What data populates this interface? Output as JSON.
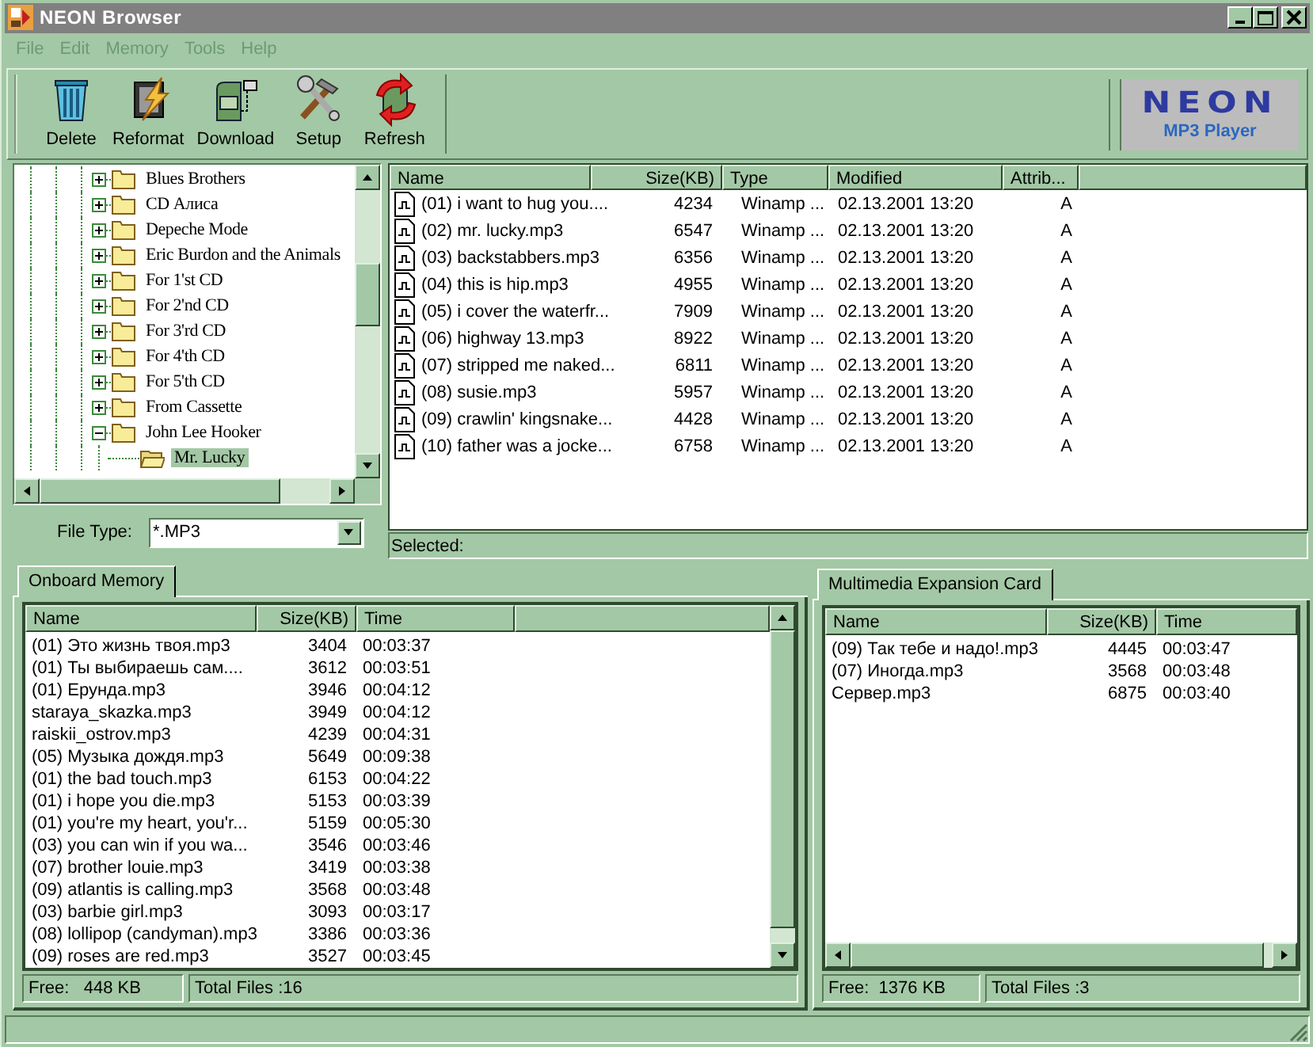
{
  "window": {
    "title": "NEON Browser"
  },
  "menu": [
    "File",
    "Edit",
    "Memory",
    "Tools",
    "Help"
  ],
  "toolbar": [
    {
      "label": "Delete",
      "kind": "delete"
    },
    {
      "label": "Reformat",
      "kind": "reformat"
    },
    {
      "label": "Download",
      "kind": "download"
    },
    {
      "label": "Setup",
      "kind": "setup"
    },
    {
      "label": "Refresh",
      "kind": "refresh"
    }
  ],
  "logo": {
    "brand": "NEON",
    "caption": "MP3 Player"
  },
  "tree": {
    "items": [
      {
        "label": "Blues Brothers",
        "expanded": false,
        "selected": false
      },
      {
        "label": "CD Алиса",
        "expanded": false,
        "selected": false
      },
      {
        "label": "Depeche Mode",
        "expanded": false,
        "selected": false
      },
      {
        "label": "Eric Burdon and the Animals",
        "expanded": false,
        "selected": false
      },
      {
        "label": "For 1'st CD",
        "expanded": false,
        "selected": false
      },
      {
        "label": "For 2'nd CD",
        "expanded": false,
        "selected": false
      },
      {
        "label": "For 3'rd CD",
        "expanded": false,
        "selected": false
      },
      {
        "label": "For 4'th CD",
        "expanded": false,
        "selected": false
      },
      {
        "label": "For 5'th CD",
        "expanded": false,
        "selected": false
      },
      {
        "label": "From Cassette",
        "expanded": false,
        "selected": false
      },
      {
        "label": "John Lee Hooker",
        "expanded": true,
        "selected": false,
        "children": [
          {
            "label": "Mr. Lucky",
            "selected": true
          }
        ]
      }
    ]
  },
  "file_type": {
    "label": "File Type:",
    "value": "*.MP3"
  },
  "files": {
    "columns": [
      "Name",
      "Size(KB)",
      "Type",
      "Modified",
      "Attrib..."
    ],
    "rows": [
      [
        "(01) i want to hug you....",
        "4234",
        "Winamp ...",
        "02.13.2001 13:20",
        "A"
      ],
      [
        "(02) mr. lucky.mp3",
        "6547",
        "Winamp ...",
        "02.13.2001 13:20",
        "A"
      ],
      [
        "(03) backstabbers.mp3",
        "6356",
        "Winamp ...",
        "02.13.2001 13:20",
        "A"
      ],
      [
        "(04) this is hip.mp3",
        "4955",
        "Winamp ...",
        "02.13.2001 13:20",
        "A"
      ],
      [
        "(05) i cover the waterfr...",
        "7909",
        "Winamp ...",
        "02.13.2001 13:20",
        "A"
      ],
      [
        "(06) highway 13.mp3",
        "8922",
        "Winamp ...",
        "02.13.2001 13:20",
        "A"
      ],
      [
        "(07) stripped me naked...",
        "6811",
        "Winamp ...",
        "02.13.2001 13:20",
        "A"
      ],
      [
        "(08) susie.mp3",
        "5957",
        "Winamp ...",
        "02.13.2001 13:20",
        "A"
      ],
      [
        "(09) crawlin' kingsnake...",
        "4428",
        "Winamp ...",
        "02.13.2001 13:20",
        "A"
      ],
      [
        "(10) father was a jocke...",
        "6758",
        "Winamp ...",
        "02.13.2001 13:20",
        "A"
      ]
    ],
    "selected_label": "Selected:"
  },
  "memories": [
    {
      "tab": "Onboard Memory",
      "columns": [
        "Name",
        "Size(KB)",
        "Time"
      ],
      "rows": [
        [
          "(01) Это жизнь твоя.mp3",
          "3404",
          "00:03:37"
        ],
        [
          "(01) Ты выбираешь сам....",
          "3612",
          "00:03:51"
        ],
        [
          "(01) Ерунда.mp3",
          "3946",
          "00:04:12"
        ],
        [
          "staraya_skazka.mp3",
          "3949",
          "00:04:12"
        ],
        [
          "raiskii_ostrov.mp3",
          "4239",
          "00:04:31"
        ],
        [
          "(05) Музыка дождя.mp3",
          "5649",
          "00:09:38"
        ],
        [
          "(01) the bad touch.mp3",
          "6153",
          "00:04:22"
        ],
        [
          "(01) i hope you die.mp3",
          "5153",
          "00:03:39"
        ],
        [
          "(01) you're my heart, you'r...",
          "5159",
          "00:05:30"
        ],
        [
          "(03) you can win if you wa...",
          "3546",
          "00:03:46"
        ],
        [
          "(07) brother louie.mp3",
          "3419",
          "00:03:38"
        ],
        [
          "(09) atlantis is calling.mp3",
          "3568",
          "00:03:48"
        ],
        [
          "(03) barbie girl.mp3",
          "3093",
          "00:03:17"
        ],
        [
          "(08) lollipop (candyman).mp3",
          "3386",
          "00:03:36"
        ],
        [
          "(09) roses are red.mp3",
          "3527",
          "00:03:45"
        ]
      ],
      "free": "Free:   448 KB",
      "total": "Total Files :16",
      "vertical_scroll": true,
      "horizontal_scroll": false
    },
    {
      "tab": "Multimedia Expansion Card",
      "columns": [
        "Name",
        "Size(KB)",
        "Time"
      ],
      "rows": [
        [
          "(09) Так тебе и надо!.mp3",
          "4445",
          "00:03:47"
        ],
        [
          "(07) Иногда.mp3",
          "3568",
          "00:03:48"
        ],
        [
          "Сервер.mp3",
          "6875",
          "00:03:40"
        ]
      ],
      "free": "Free:  1376 KB",
      "total": "Total Files :3",
      "vertical_scroll": false,
      "horizontal_scroll": true
    }
  ]
}
